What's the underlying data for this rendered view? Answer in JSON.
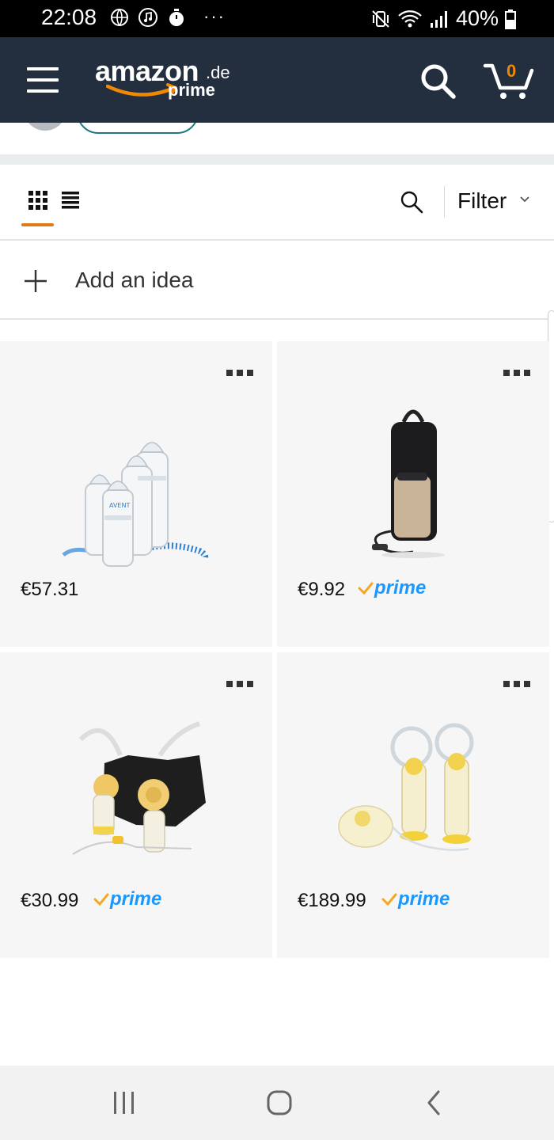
{
  "status_bar": {
    "time": "22:08",
    "more": "···",
    "battery": "40%"
  },
  "header": {
    "logo_word": "amazon",
    "logo_domain": ".de",
    "logo_prime": "prime",
    "cart_count": "0",
    "colors": {
      "bar": "#232f3e",
      "accent": "#f08804"
    }
  },
  "toolbar": {
    "filter_label": "Filter",
    "active_view": "grid"
  },
  "add_idea": {
    "label": "Add an idea"
  },
  "products": [
    {
      "price": "€57.31",
      "prime": false,
      "image": "baby-bottles-set"
    },
    {
      "price": "€9.92",
      "prime": true,
      "prime_label": "prime",
      "image": "bottle-cooler-bag"
    },
    {
      "price": "€30.99",
      "prime": true,
      "prime_label": "prime",
      "image": "hands-free-pumping-bra"
    },
    {
      "price": "€189.99",
      "prime": true,
      "prime_label": "prime",
      "image": "double-breast-pump"
    }
  ],
  "colors": {
    "prime_blue": "#1a98ff",
    "prime_check": "#f5a623",
    "underline": "#e47911"
  }
}
